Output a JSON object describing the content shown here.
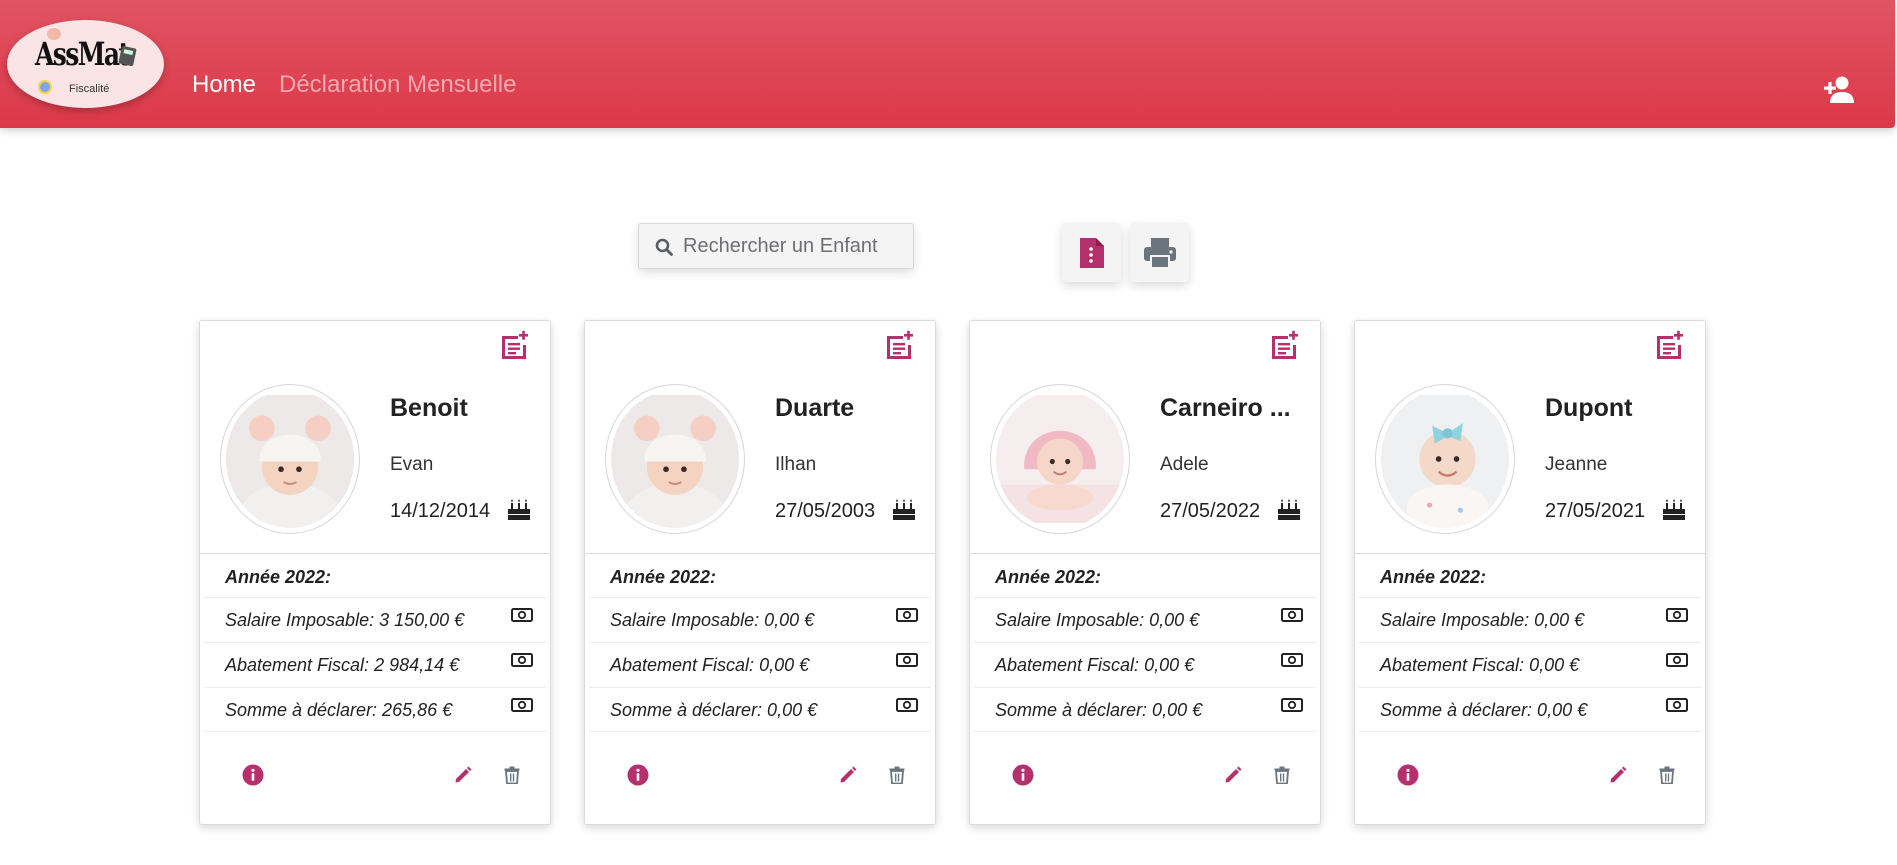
{
  "app": {
    "logo_text": "AssMat",
    "logo_subtitle": "Fiscalité"
  },
  "nav": {
    "home": "Home",
    "declaration": "Déclaration Mensuelle"
  },
  "search": {
    "placeholder": "Rechercher un Enfant"
  },
  "colors": {
    "navbar": "#dc3848",
    "accent": "#b5316d",
    "icon_gray": "#6c757d"
  },
  "icons": {
    "add_user": "person-plus-icon",
    "pdf": "file-pdf-icon",
    "print": "printer-icon",
    "add_note": "note-plus-icon",
    "cake": "birthday-cake-icon",
    "money": "banknote-icon",
    "info": "info-circle-icon",
    "edit": "pencil-icon",
    "delete": "trash-icon"
  },
  "cards": [
    {
      "nom": "Benoit",
      "prenom": "Evan",
      "dob": "14/12/2014",
      "annee": "Année 2022:",
      "salaire": "Salaire Imposable: 3 150,00 €",
      "abattement": "Abatement Fiscal: 2 984,14 €",
      "somme": "Somme à déclarer: 265,86 €",
      "photo": "baby-white-hat"
    },
    {
      "nom": "Duarte",
      "prenom": "Ilhan",
      "dob": "27/05/2003",
      "annee": "Année 2022:",
      "salaire": "Salaire Imposable: 0,00 €",
      "abattement": "Abatement Fiscal: 0,00 €",
      "somme": "Somme à déclarer: 0,00 €",
      "photo": "baby-white-hat"
    },
    {
      "nom": "Carneiro ...",
      "prenom": "Adele",
      "dob": "27/05/2022",
      "annee": "Année 2022:",
      "salaire": "Salaire Imposable: 0,00 €",
      "abattement": "Abatement Fiscal: 0,00 €",
      "somme": "Somme à déclarer: 0,00 €",
      "photo": "baby-pink-towel"
    },
    {
      "nom": "Dupont",
      "prenom": "Jeanne",
      "dob": "27/05/2021",
      "annee": "Année 2022:",
      "salaire": "Salaire Imposable: 0,00 €",
      "abattement": "Abatement Fiscal: 0,00 €",
      "somme": "Somme à déclarer: 0,00 €",
      "photo": "baby-blue-bow"
    }
  ]
}
